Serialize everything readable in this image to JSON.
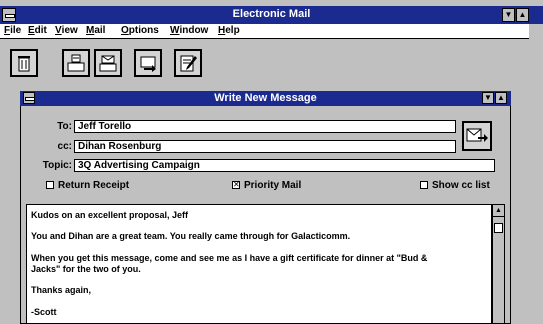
{
  "app": {
    "title": "Electronic Mail"
  },
  "menu": [
    {
      "label": "File",
      "ul": "F",
      "rest": "ile"
    },
    {
      "label": "Edit",
      "ul": "E",
      "rest": "dit"
    },
    {
      "label": "View",
      "ul": "V",
      "rest": "iew"
    },
    {
      "label": "Mail",
      "ul": "M",
      "rest": "ail"
    },
    {
      "label": "Options",
      "ul": "O",
      "rest": "ptions"
    },
    {
      "label": "Window",
      "ul": "W",
      "rest": "indow"
    },
    {
      "label": "Help",
      "ul": "H",
      "rest": "elp"
    }
  ],
  "toolbar": {
    "icons": [
      "trash-icon",
      "inbox-icon",
      "outbox-icon",
      "forward-icon",
      "compose-icon"
    ]
  },
  "compose": {
    "title": "Write New Message",
    "to_label": "To:",
    "to_value": "Jeff Torello",
    "cc_label": "cc:",
    "cc_value": "Dihan Rosenburg",
    "topic_label": "Topic:",
    "topic_value": "3Q Advertising Campaign",
    "return_receipt": {
      "label": "Return Receipt",
      "checked": false
    },
    "priority_mail": {
      "label": "Priority Mail",
      "checked": true
    },
    "show_cc": {
      "label": "Show cc list",
      "checked": false
    },
    "send_icon": "send-icon",
    "body_lines": [
      "Kudos on an excellent proposal, Jeff",
      "You and Dihan are a great team. You really came through for Galacticomm.",
      "When you get this message, come and see me as I have a gift certificate for dinner at \"Bud &",
      "Jacks\" for the two of you.",
      "Thanks again,",
      "-Scott"
    ]
  },
  "colors": {
    "titlebar": "#1b2a8e",
    "chrome": "#c0c0c0"
  }
}
